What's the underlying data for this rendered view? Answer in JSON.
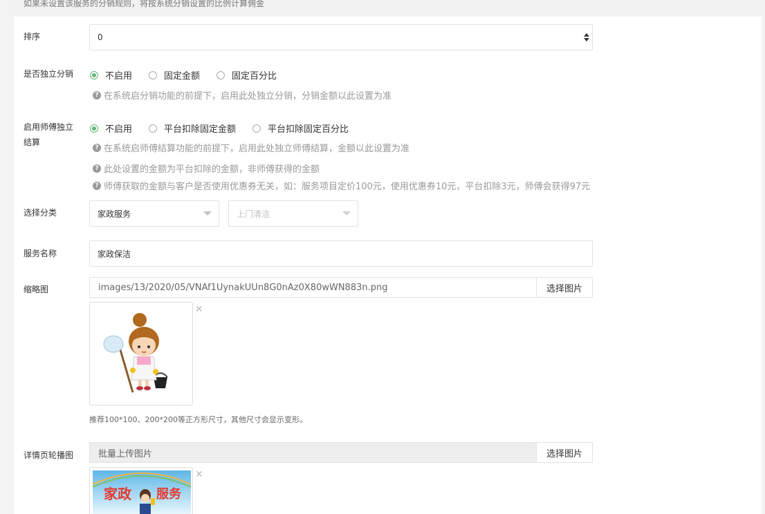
{
  "banner": {
    "text": "如果未设置该服务的分销规则，将按系统分销设置的比例计算佣金"
  },
  "sort": {
    "label": "排序",
    "value": "0"
  },
  "independent_distribution": {
    "label": "是否独立分销",
    "options": [
      "不启用",
      "固定金额",
      "固定百分比"
    ],
    "selected": 0,
    "tip": "在系统启分销功能的前提下，启用此处独立分销，分销金额以此设置为准"
  },
  "master_settlement": {
    "label_line1": "启用师傅独立",
    "label_line2": "结算",
    "options": [
      "不启用",
      "平台扣除固定金额",
      "平台扣除固定百分比"
    ],
    "selected": 0,
    "tips": [
      "在系统启师傅结算功能的前提下，启用此处独立师傅结算，金额以此设置为准",
      "此处设置的金额为平台扣除的金额，非师傅获得的金额",
      "师傅获取的金额与客户是否使用优惠券无关，如：服务项目定价100元，使用优惠券10元，平台扣除3元，师傅会获得97元"
    ]
  },
  "category": {
    "label": "选择分类",
    "primary": "家政服务",
    "secondary_placeholder": "上门清洁"
  },
  "service_name": {
    "label": "服务名称",
    "value": "家政保洁"
  },
  "thumbnail": {
    "label": "缩略图",
    "path": "images/13/2020/05/VNAf1UynakUUn8G0nAz0X80wWN883n.png",
    "button": "选择图片",
    "hint": "推荐100*100、200*200等正方形尺寸，其他尺寸会显示变形。"
  },
  "carousel": {
    "label": "详情页轮播图",
    "placeholder": "批量上传图片",
    "button": "选择图片",
    "banner_text_left": "家政",
    "banner_text_right": "服务"
  },
  "icons": {
    "close": "close-icon",
    "question": "question-circle-icon",
    "dropdown": "caret-down-icon"
  },
  "colors": {
    "accent": "#5fb878",
    "tip": "#999999",
    "border": "#e2e2e2"
  }
}
